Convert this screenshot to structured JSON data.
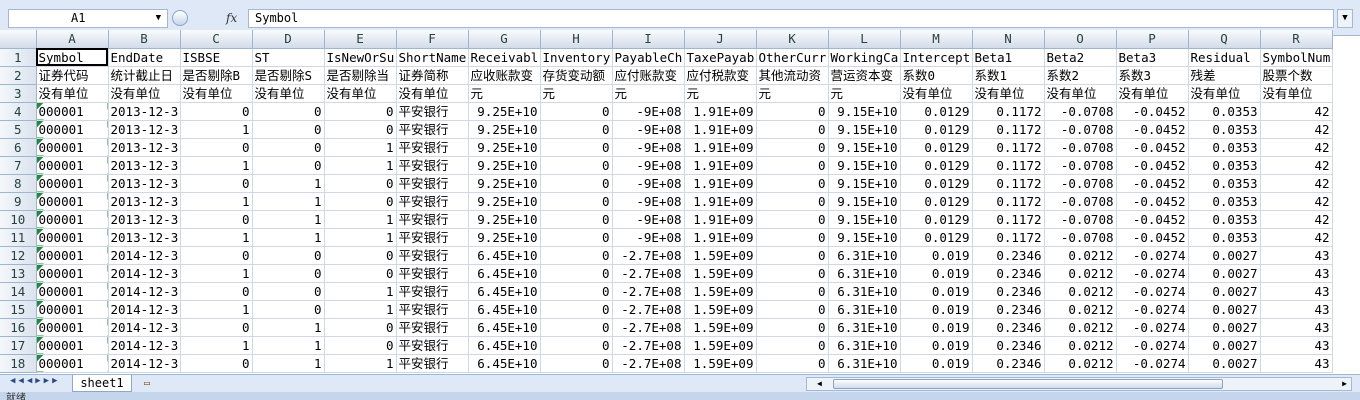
{
  "formula_bar": {
    "name_box": "A1",
    "fx_label": "fx",
    "content": "Symbol"
  },
  "columns": [
    "A",
    "B",
    "C",
    "D",
    "E",
    "F",
    "G",
    "H",
    "I",
    "J",
    "K",
    "L",
    "M",
    "N",
    "O",
    "P",
    "Q",
    "R"
  ],
  "rows": [
    {
      "n": "1",
      "cells": [
        "Symbol",
        "EndDate",
        "ISBSE",
        "ST",
        "IsNewOrSu",
        "ShortName",
        "Receivabl",
        "Inventory",
        "PayableCh",
        "TaxePayab",
        "OtherCurr",
        "WorkingCa",
        "Intercept",
        "Beta1",
        "Beta2",
        "Beta3",
        "Residual",
        "SymbolNum"
      ]
    },
    {
      "n": "2",
      "cells": [
        "证券代码",
        "统计截止日",
        "是否剔除B",
        "是否剔除S",
        "是否剔除当",
        "证券简称",
        "应收账款变",
        "存货变动额",
        "应付账款变",
        "应付税款变",
        "其他流动资",
        "营运资本变",
        "系数0",
        "系数1",
        "系数2",
        "系数3",
        "残差",
        "股票个数"
      ]
    },
    {
      "n": "3",
      "cells": [
        "没有单位",
        "没有单位",
        "没有单位",
        "没有单位",
        "没有单位",
        "没有单位",
        "元",
        "元",
        "元",
        "元",
        "元",
        "元",
        "没有单位",
        "没有单位",
        "没有单位",
        "没有单位",
        "没有单位",
        "没有单位"
      ]
    },
    {
      "n": "4",
      "cells": [
        "000001",
        "2013-12-3",
        "0",
        "0",
        "0",
        "平安银行",
        "9.25E+10",
        "0",
        "-9E+08",
        "1.91E+09",
        "0",
        "9.15E+10",
        "0.0129",
        "0.1172",
        "-0.0708",
        "-0.0452",
        "0.0353",
        "42"
      ]
    },
    {
      "n": "5",
      "cells": [
        "000001",
        "2013-12-3",
        "1",
        "0",
        "0",
        "平安银行",
        "9.25E+10",
        "0",
        "-9E+08",
        "1.91E+09",
        "0",
        "9.15E+10",
        "0.0129",
        "0.1172",
        "-0.0708",
        "-0.0452",
        "0.0353",
        "42"
      ]
    },
    {
      "n": "6",
      "cells": [
        "000001",
        "2013-12-3",
        "0",
        "0",
        "1",
        "平安银行",
        "9.25E+10",
        "0",
        "-9E+08",
        "1.91E+09",
        "0",
        "9.15E+10",
        "0.0129",
        "0.1172",
        "-0.0708",
        "-0.0452",
        "0.0353",
        "42"
      ]
    },
    {
      "n": "7",
      "cells": [
        "000001",
        "2013-12-3",
        "1",
        "0",
        "1",
        "平安银行",
        "9.25E+10",
        "0",
        "-9E+08",
        "1.91E+09",
        "0",
        "9.15E+10",
        "0.0129",
        "0.1172",
        "-0.0708",
        "-0.0452",
        "0.0353",
        "42"
      ]
    },
    {
      "n": "8",
      "cells": [
        "000001",
        "2013-12-3",
        "0",
        "1",
        "0",
        "平安银行",
        "9.25E+10",
        "0",
        "-9E+08",
        "1.91E+09",
        "0",
        "9.15E+10",
        "0.0129",
        "0.1172",
        "-0.0708",
        "-0.0452",
        "0.0353",
        "42"
      ]
    },
    {
      "n": "9",
      "cells": [
        "000001",
        "2013-12-3",
        "1",
        "1",
        "0",
        "平安银行",
        "9.25E+10",
        "0",
        "-9E+08",
        "1.91E+09",
        "0",
        "9.15E+10",
        "0.0129",
        "0.1172",
        "-0.0708",
        "-0.0452",
        "0.0353",
        "42"
      ]
    },
    {
      "n": "10",
      "cells": [
        "000001",
        "2013-12-3",
        "0",
        "1",
        "1",
        "平安银行",
        "9.25E+10",
        "0",
        "-9E+08",
        "1.91E+09",
        "0",
        "9.15E+10",
        "0.0129",
        "0.1172",
        "-0.0708",
        "-0.0452",
        "0.0353",
        "42"
      ]
    },
    {
      "n": "11",
      "cells": [
        "000001",
        "2013-12-3",
        "1",
        "1",
        "1",
        "平安银行",
        "9.25E+10",
        "0",
        "-9E+08",
        "1.91E+09",
        "0",
        "9.15E+10",
        "0.0129",
        "0.1172",
        "-0.0708",
        "-0.0452",
        "0.0353",
        "42"
      ]
    },
    {
      "n": "12",
      "cells": [
        "000001",
        "2014-12-3",
        "0",
        "0",
        "0",
        "平安银行",
        "6.45E+10",
        "0",
        "-2.7E+08",
        "1.59E+09",
        "0",
        "6.31E+10",
        "0.019",
        "0.2346",
        "0.0212",
        "-0.0274",
        "0.0027",
        "43"
      ]
    },
    {
      "n": "13",
      "cells": [
        "000001",
        "2014-12-3",
        "1",
        "0",
        "0",
        "平安银行",
        "6.45E+10",
        "0",
        "-2.7E+08",
        "1.59E+09",
        "0",
        "6.31E+10",
        "0.019",
        "0.2346",
        "0.0212",
        "-0.0274",
        "0.0027",
        "43"
      ]
    },
    {
      "n": "14",
      "cells": [
        "000001",
        "2014-12-3",
        "0",
        "0",
        "1",
        "平安银行",
        "6.45E+10",
        "0",
        "-2.7E+08",
        "1.59E+09",
        "0",
        "6.31E+10",
        "0.019",
        "0.2346",
        "0.0212",
        "-0.0274",
        "0.0027",
        "43"
      ]
    },
    {
      "n": "15",
      "cells": [
        "000001",
        "2014-12-3",
        "1",
        "0",
        "1",
        "平安银行",
        "6.45E+10",
        "0",
        "-2.7E+08",
        "1.59E+09",
        "0",
        "6.31E+10",
        "0.019",
        "0.2346",
        "0.0212",
        "-0.0274",
        "0.0027",
        "43"
      ]
    },
    {
      "n": "16",
      "cells": [
        "000001",
        "2014-12-3",
        "0",
        "1",
        "0",
        "平安银行",
        "6.45E+10",
        "0",
        "-2.7E+08",
        "1.59E+09",
        "0",
        "6.31E+10",
        "0.019",
        "0.2346",
        "0.0212",
        "-0.0274",
        "0.0027",
        "43"
      ]
    },
    {
      "n": "17",
      "cells": [
        "000001",
        "2014-12-3",
        "1",
        "1",
        "0",
        "平安银行",
        "6.45E+10",
        "0",
        "-2.7E+08",
        "1.59E+09",
        "0",
        "6.31E+10",
        "0.019",
        "0.2346",
        "0.0212",
        "-0.0274",
        "0.0027",
        "43"
      ]
    },
    {
      "n": "18",
      "cells": [
        "000001",
        "2014-12-3",
        "0",
        "1",
        "1",
        "平安银行",
        "6.45E+10",
        "0",
        "-2.7E+08",
        "1.59E+09",
        "0",
        "6.31E+10",
        "0.019",
        "0.2346",
        "0.0212",
        "-0.0274",
        "0.0027",
        "43"
      ]
    }
  ],
  "sheet_tabs": [
    "sheet1"
  ],
  "status": {
    "text": "就绪"
  },
  "icons": {
    "nav": "sheet-nav-arrows-icon",
    "new_sheet": "insert-sheet-icon",
    "expand": "expand-formula-bar-icon",
    "dropdown": "chevron-down-icon"
  },
  "colors": {
    "chrome": "#dfe8f6",
    "grid_line": "#d0d7e5",
    "header_border": "#9eb6ce",
    "error_flag": "#1e8a3b"
  }
}
